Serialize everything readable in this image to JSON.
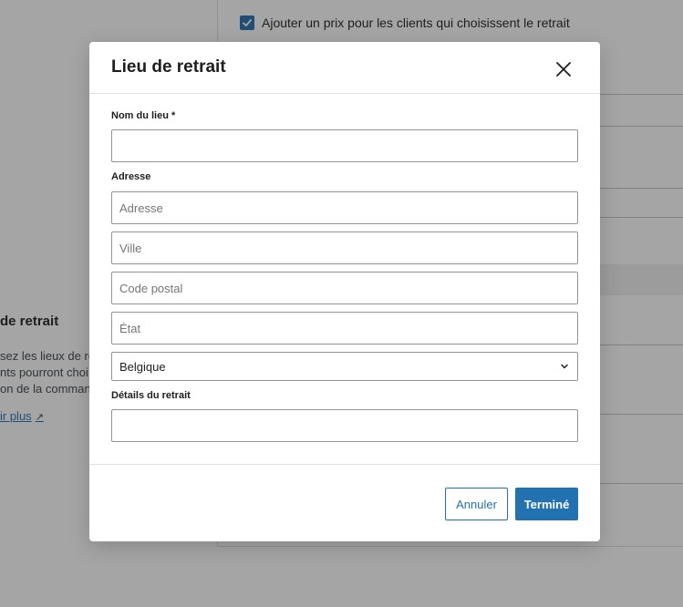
{
  "background": {
    "checkbox_label": "Ajouter un prix pour les clients qui choisissent le retrait",
    "section_heading": "de retrait",
    "section_text_lines": [
      "sez les lieux de ret",
      "nts pourront choi",
      "on de la comman"
    ],
    "learn_more_link": "ir plus",
    "external_icon": "↗"
  },
  "modal": {
    "title": "Lieu de retrait",
    "close_icon": "close-icon",
    "fields": {
      "location_name_label": "Nom du lieu *",
      "location_name_value": "",
      "address_section_label": "Adresse",
      "address_placeholder": "Adresse",
      "city_placeholder": "Ville",
      "postal_code_placeholder": "Code postal",
      "state_placeholder": "État",
      "country_value": "Belgique",
      "pickup_details_label": "Détails du retrait",
      "pickup_details_value": ""
    },
    "footer": {
      "cancel_label": "Annuler",
      "done_label": "Terminé"
    }
  },
  "colors": {
    "accent": "#2271b1",
    "overlay": "rgba(30,30,30,0.40)"
  }
}
